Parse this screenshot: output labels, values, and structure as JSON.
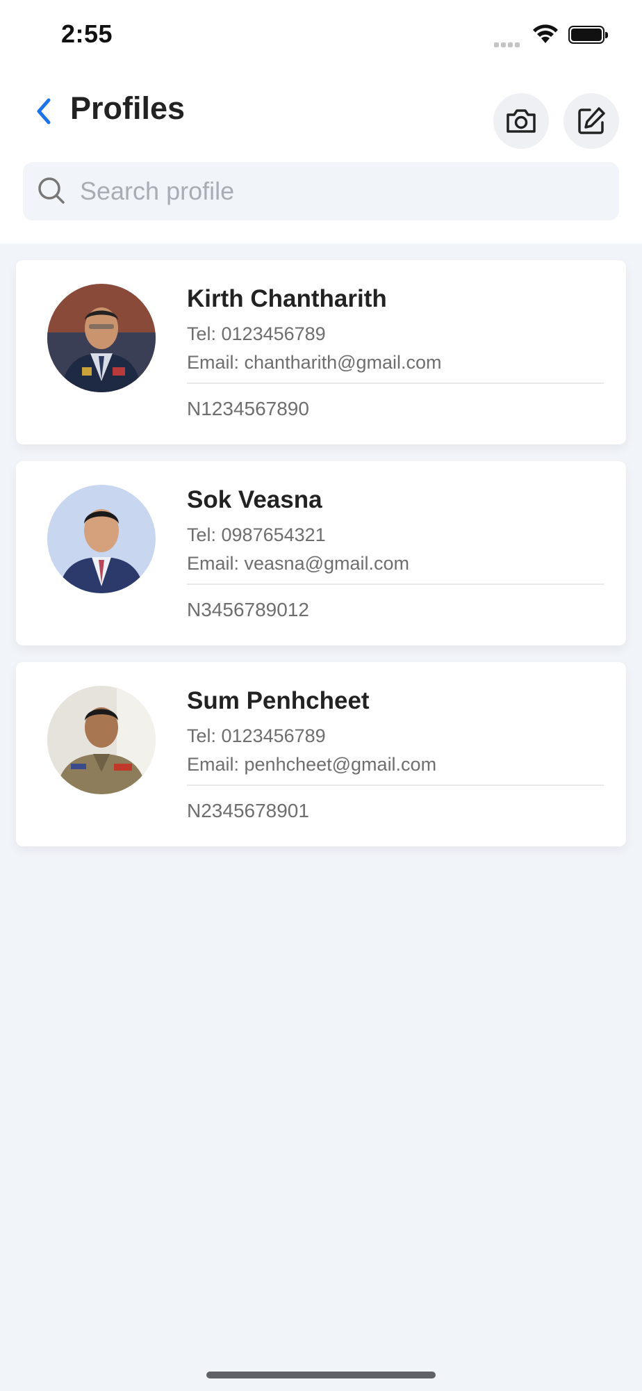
{
  "status": {
    "time": "2:55"
  },
  "header": {
    "title": "Profiles",
    "back_icon": "chevron-left-icon",
    "actions": [
      "camera-icon",
      "edit-icon"
    ],
    "accent_color": "#1a73e8"
  },
  "search": {
    "placeholder": "Search profile",
    "value": ""
  },
  "profiles": [
    {
      "name": "Kirth Chantharith",
      "tel": "Tel: 0123456789",
      "email": "Email: chantharith@gmail.com",
      "id": "N1234567890"
    },
    {
      "name": "Sok Veasna",
      "tel": "Tel: 0987654321",
      "email": "Email: veasna@gmail.com",
      "id": "N3456789012"
    },
    {
      "name": "Sum Penhcheet",
      "tel": "Tel: 0123456789",
      "email": "Email: penhcheet@gmail.com",
      "id": "N2345678901"
    }
  ],
  "colors": {
    "background": "#f1f4f8",
    "card": "#ffffff",
    "text_primary": "#222222",
    "text_secondary": "#6e6e6e"
  }
}
